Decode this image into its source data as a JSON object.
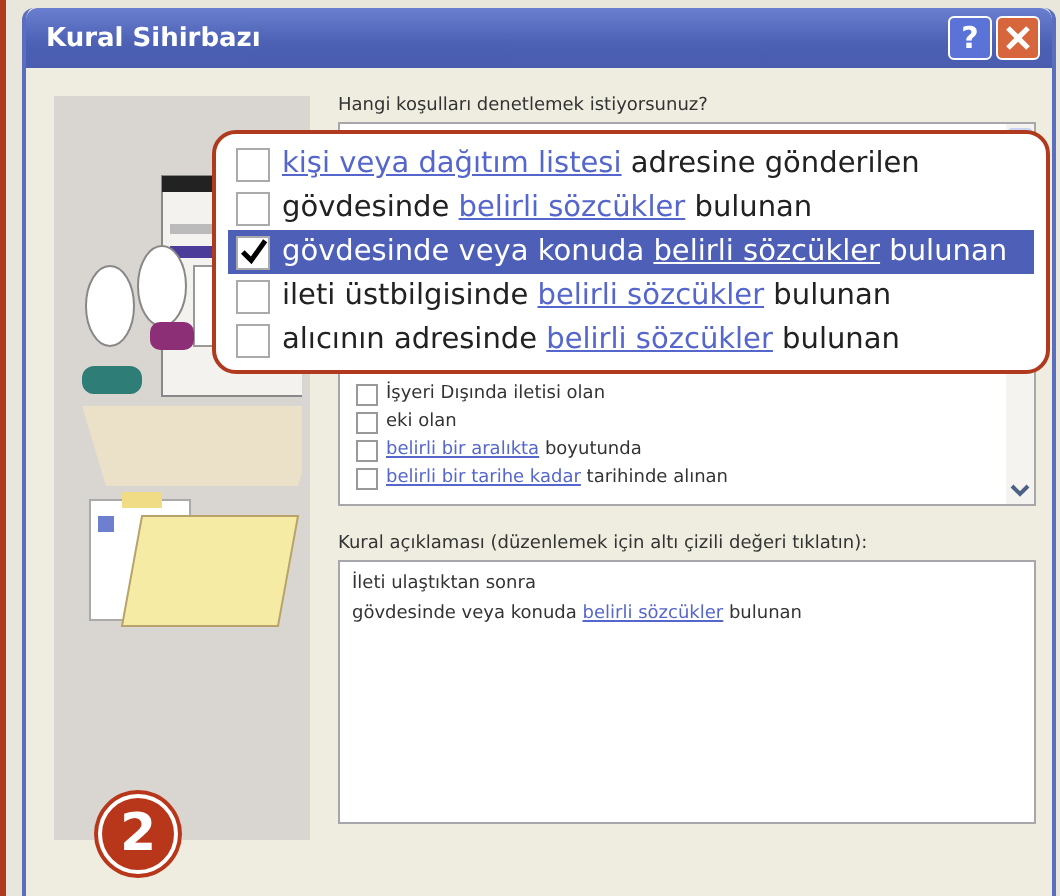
{
  "window": {
    "title": "Kural Sihirbazı",
    "help_button": "?"
  },
  "conditions_prompt": "Hangi koşulları denetlemek istiyorsunuz?",
  "magnified_conditions": [
    {
      "checked": false,
      "selected": false,
      "parts": [
        {
          "kind": "link",
          "text": "kişi veya dağıtım listesi"
        },
        {
          "kind": "text",
          "text": " adresine gönderilen"
        }
      ]
    },
    {
      "checked": false,
      "selected": false,
      "parts": [
        {
          "kind": "text",
          "text": "gövdesinde "
        },
        {
          "kind": "link",
          "text": "belirli sözcükler"
        },
        {
          "kind": "text",
          "text": " bulunan"
        }
      ]
    },
    {
      "checked": true,
      "selected": true,
      "parts": [
        {
          "kind": "text",
          "text": "gövdesinde veya konuda "
        },
        {
          "kind": "link",
          "text": "belirli sözcükler"
        },
        {
          "kind": "text",
          "text": " bulunan"
        }
      ]
    },
    {
      "checked": false,
      "selected": false,
      "parts": [
        {
          "kind": "text",
          "text": "ileti üstbilgisinde "
        },
        {
          "kind": "link",
          "text": "belirli sözcükler"
        },
        {
          "kind": "text",
          "text": " bulunan"
        }
      ]
    },
    {
      "checked": false,
      "selected": false,
      "parts": [
        {
          "kind": "text",
          "text": "alıcının adresinde "
        },
        {
          "kind": "link",
          "text": "belirli sözcükler"
        },
        {
          "kind": "text",
          "text": " bulunan"
        }
      ]
    }
  ],
  "conditions": [
    {
      "checked": false,
      "selected": false,
      "parts": [
        {
          "kind": "text",
          "text": "İşyeri Dışında iletisi olan"
        }
      ]
    },
    {
      "checked": false,
      "selected": false,
      "parts": [
        {
          "kind": "text",
          "text": "eki olan"
        }
      ]
    },
    {
      "checked": false,
      "selected": false,
      "parts": [
        {
          "kind": "link",
          "text": "belirli bir aralıkta"
        },
        {
          "kind": "text",
          "text": " boyutunda"
        }
      ]
    },
    {
      "checked": false,
      "selected": false,
      "parts": [
        {
          "kind": "link",
          "text": "belirli bir tarihe kadar"
        },
        {
          "kind": "text",
          "text": " tarihinde alınan"
        }
      ]
    }
  ],
  "description_label": "Kural açıklaması (düzenlemek için altı çizili değeri tıklatın):",
  "description_lines": [
    {
      "parts": [
        {
          "kind": "text",
          "text": "İleti ulaştıktan sonra"
        }
      ]
    },
    {
      "parts": [
        {
          "kind": "text",
          "text": "gövdesinde veya konuda "
        },
        {
          "kind": "link",
          "text": "belirli sözcükler"
        },
        {
          "kind": "text",
          "text": " bulunan"
        }
      ]
    }
  ],
  "step_badge": "2"
}
